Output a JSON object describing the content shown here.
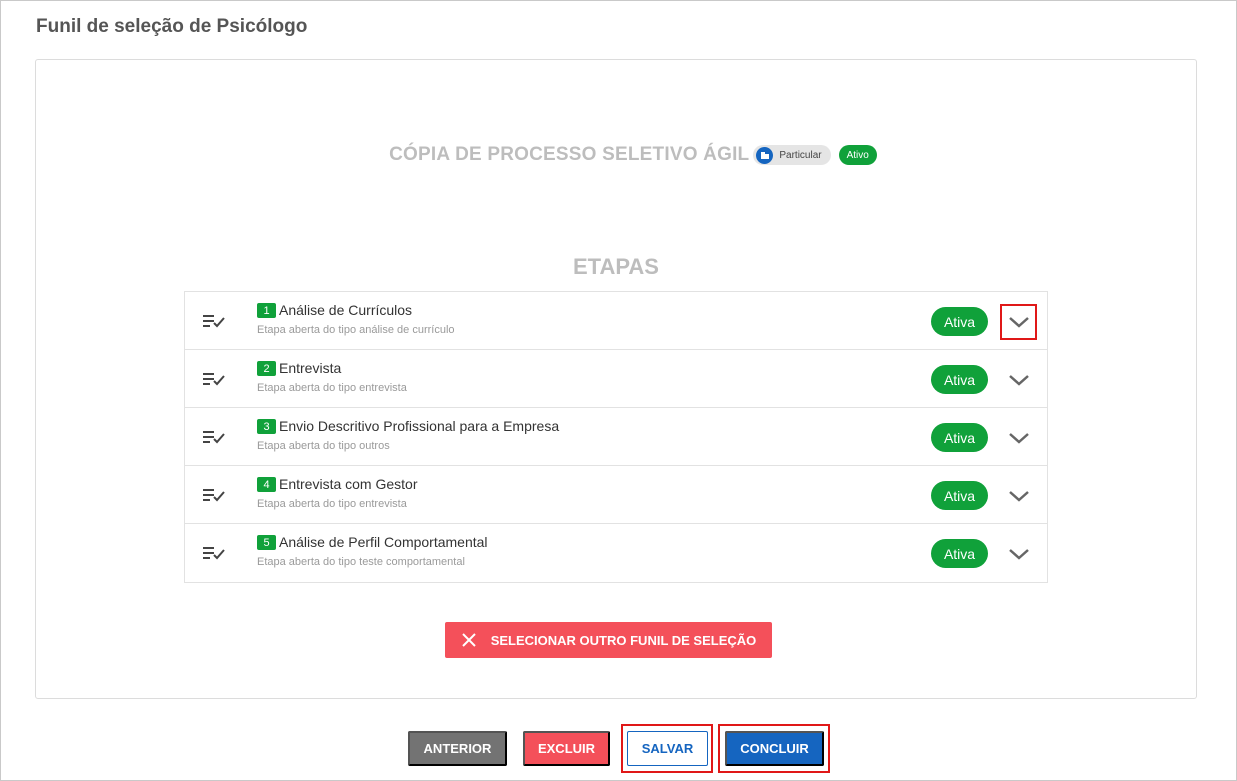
{
  "page": {
    "title": "Funil de seleção de Psicólogo"
  },
  "process": {
    "title": "CÓPIA DE PROCESSO SELETIVO ÁGIL",
    "type_badge": "Particular",
    "status_badge": "Ativo"
  },
  "stages_section": {
    "title": "ETAPAS",
    "items": [
      {
        "number": "1",
        "name": "Análise de Currículos",
        "description": "Etapa aberta do tipo análise de currículo",
        "status": "Ativa"
      },
      {
        "number": "2",
        "name": "Entrevista",
        "description": "Etapa aberta do tipo entrevista",
        "status": "Ativa"
      },
      {
        "number": "3",
        "name": "Envio Descritivo Profissional para a Empresa",
        "description": "Etapa aberta do tipo outros",
        "status": "Ativa"
      },
      {
        "number": "4",
        "name": "Entrevista com Gestor",
        "description": "Etapa aberta do tipo entrevista",
        "status": "Ativa"
      },
      {
        "number": "5",
        "name": "Análise de Perfil Comportamental",
        "description": "Etapa aberta do tipo teste comportamental",
        "status": "Ativa"
      }
    ]
  },
  "actions": {
    "select_other_funnel": "SELECIONAR OUTRO FUNIL DE SELEÇÃO",
    "previous": "ANTERIOR",
    "delete": "EXCLUIR",
    "save": "SALVAR",
    "finish": "CONCLUIR"
  },
  "icons": {
    "stage_list": "playlist-check-icon",
    "expand": "chevron-down-icon",
    "remove": "close-icon",
    "type_badge": "building-icon"
  },
  "colors": {
    "status_green": "#10a13a",
    "primary_blue": "#1565c0",
    "danger_red": "#f4505a",
    "highlight_red": "#e01818"
  }
}
